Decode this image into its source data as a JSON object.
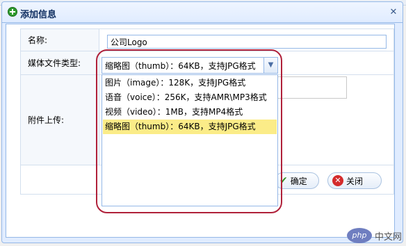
{
  "dialog": {
    "title": "添加信息",
    "close_glyph": "✕"
  },
  "form": {
    "name_label": "名称:",
    "name_value": "公司Logo",
    "media_type_label": "媒体文件类型:",
    "media_type_selected": "缩略图（thumb）：64KB，支持JPG格式",
    "upload_label": "附件上传:"
  },
  "dropdown": {
    "options": [
      "图片（image）：128K，支持JPG格式",
      "语音（voice）：256K，支持AMR\\MP3格式",
      "视频（video）：1MB，支持MP4格式",
      "缩略图（thumb）：64KB，支持JPG格式"
    ],
    "selected_index": 3
  },
  "buttons": {
    "ok": "确定",
    "close": "关闭"
  },
  "watermark": {
    "badge": "php",
    "text": "中文网"
  },
  "colors": {
    "highlight_ring": "#b0213a",
    "selected_option_bg": "#fbec88",
    "border_blue": "#95b8e7"
  }
}
